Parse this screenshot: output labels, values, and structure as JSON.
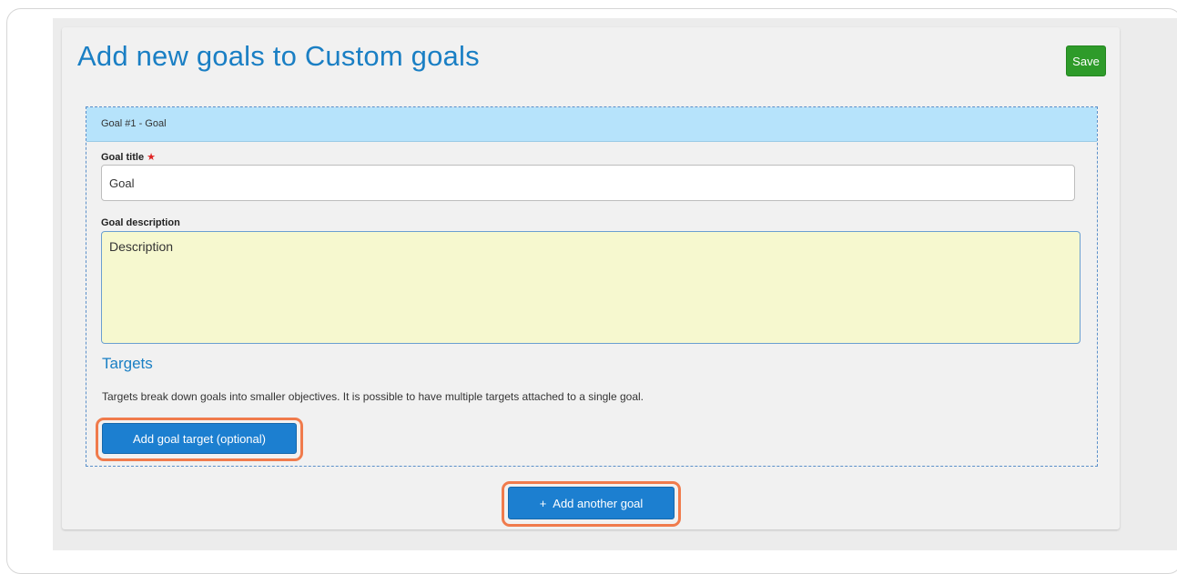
{
  "header": {
    "title": "Add new goals to Custom goals",
    "save_label": "Save"
  },
  "goal_card": {
    "header_label": "Goal #1 - Goal",
    "title_label": "Goal title",
    "required_mark": "★",
    "title_value": "Goal",
    "description_label": "Goal description",
    "description_value": "Description",
    "targets_heading": "Targets",
    "targets_help": "Targets break down goals into smaller objectives. It is possible to have multiple targets attached to a single goal.",
    "add_target_label": "Add goal target (optional)"
  },
  "footer": {
    "plus_glyph": "+",
    "add_goal_label": "Add another goal"
  },
  "colors": {
    "accent_blue": "#1a7fc4",
    "save_green": "#2e9b2a",
    "header_light_blue": "#b6e3fb",
    "textarea_yellow": "#f6f8cf",
    "highlight_orange": "#f07b4c"
  }
}
